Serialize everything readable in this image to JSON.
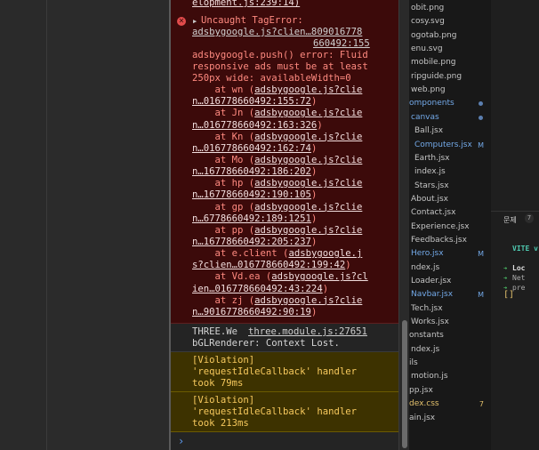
{
  "console": {
    "error": {
      "top_line": "elopment.js:239:14)",
      "title": "Uncaught TagError:",
      "title_link": "adsbygoogle.js?clien…809016778",
      "title_link2": "660492:155",
      "msg1": "adsbygoogle.push() error: Fluid",
      "msg2": "responsive ads must be at least",
      "msg3": "250px wide: availableWidth=0",
      "stack": [
        {
          "prefix": "    at wn (",
          "link": "adsbygoogle.js?clie",
          "link2": "n…016778660492:155:72",
          "suffix": ")"
        },
        {
          "prefix": "    at Jn (",
          "link": "adsbygoogle.js?clie",
          "link2": "n…016778660492:163:326",
          "suffix": ")"
        },
        {
          "prefix": "    at Kn (",
          "link": "adsbygoogle.js?clie",
          "link2": "n…016778660492:162:74",
          "suffix": ")"
        },
        {
          "prefix": "    at Mo (",
          "link": "adsbygoogle.js?clie",
          "link2": "n…16778660492:186:202",
          "suffix": ")"
        },
        {
          "prefix": "    at hp (",
          "link": "adsbygoogle.js?clie",
          "link2": "n…16778660492:190:105",
          "suffix": ")"
        },
        {
          "prefix": "    at gp (",
          "link": "adsbygoogle.js?clie",
          "link2": "n…6778660492:189:1251",
          "suffix": ")"
        },
        {
          "prefix": "    at pp (",
          "link": "adsbygoogle.js?clie",
          "link2": "n…16778660492:205:237",
          "suffix": ")"
        },
        {
          "prefix": "    at e.client (",
          "link": "adsbygoogle.j",
          "link2": "s?clien…016778660492:199:42",
          "suffix": ")"
        },
        {
          "prefix": "    at Vd.ea (",
          "link": "adsbygoogle.js?cl",
          "link2": "ien…016778660492:43:224",
          "suffix": ")"
        },
        {
          "prefix": "    at zj (",
          "link": "adsbygoogle.js?clie",
          "link2": "n…9016778660492:90:19",
          "suffix": ")"
        }
      ]
    },
    "info": {
      "text1": "THREE.We",
      "link": "three.module.js:27651",
      "text2": "bGLRenderer: Context Lost."
    },
    "warn1": [
      "[Violation]",
      "'requestIdleCallback' handler",
      "took 79ms"
    ],
    "warn2": [
      "[Violation]",
      "'requestIdleCallback' handler",
      "took 213ms"
    ],
    "prompt": "›"
  },
  "explorer": {
    "items": [
      {
        "name": "obit.png",
        "x": 2,
        "color": "",
        "badge": ""
      },
      {
        "name": "cosy.svg",
        "x": 2,
        "color": "",
        "badge": ""
      },
      {
        "name": "ogotab.png",
        "x": 2,
        "color": "",
        "badge": ""
      },
      {
        "name": "enu.svg",
        "x": 2,
        "color": "",
        "badge": ""
      },
      {
        "name": "mobile.png",
        "x": 2,
        "color": "",
        "badge": ""
      },
      {
        "name": "ripguide.png",
        "x": 2,
        "color": "",
        "badge": ""
      },
      {
        "name": "web.png",
        "x": 2,
        "color": "",
        "badge": ""
      },
      {
        "name": "omponents",
        "x": 0,
        "color": "blue",
        "badge": "dot"
      },
      {
        "name": "canvas",
        "x": 2,
        "color": "blue",
        "badge": "dot"
      },
      {
        "name": "Ball.jsx",
        "x": 6,
        "color": "",
        "badge": ""
      },
      {
        "name": "Computers.jsx",
        "x": 6,
        "color": "blue",
        "badge": "M"
      },
      {
        "name": "Earth.jsx",
        "x": 6,
        "color": "",
        "badge": ""
      },
      {
        "name": "index.js",
        "x": 6,
        "color": "",
        "badge": ""
      },
      {
        "name": "Stars.jsx",
        "x": 6,
        "color": "",
        "badge": ""
      },
      {
        "name": "About.jsx",
        "x": 2,
        "color": "",
        "badge": ""
      },
      {
        "name": "Contact.jsx",
        "x": 2,
        "color": "",
        "badge": ""
      },
      {
        "name": "Experience.jsx",
        "x": 2,
        "color": "",
        "badge": ""
      },
      {
        "name": "Feedbacks.jsx",
        "x": 2,
        "color": "",
        "badge": ""
      },
      {
        "name": "Hero.jsx",
        "x": 2,
        "color": "blue",
        "badge": "M"
      },
      {
        "name": "ndex.js",
        "x": 2,
        "color": "",
        "badge": ""
      },
      {
        "name": "Loader.jsx",
        "x": 2,
        "color": "",
        "badge": ""
      },
      {
        "name": "Navbar.jsx",
        "x": 2,
        "color": "blue",
        "badge": "M"
      },
      {
        "name": "Tech.jsx",
        "x": 2,
        "color": "",
        "badge": ""
      },
      {
        "name": "Works.jsx",
        "x": 2,
        "color": "",
        "badge": ""
      },
      {
        "name": "onstants",
        "x": 0,
        "color": "",
        "badge": ""
      },
      {
        "name": "ndex.js",
        "x": 2,
        "color": "",
        "badge": ""
      },
      {
        "name": "ils",
        "x": 0,
        "color": "",
        "badge": ""
      },
      {
        "name": "motion.js",
        "x": 2,
        "color": "",
        "badge": ""
      },
      {
        "name": "pp.jsx",
        "x": 0,
        "color": "",
        "badge": ""
      },
      {
        "name": "dex.css",
        "x": 0,
        "color": "yellow",
        "badge": "7"
      },
      {
        "name": "ain.jsx",
        "x": 0,
        "color": "",
        "badge": ""
      }
    ]
  },
  "terminal": {
    "tab_label": "문제",
    "tab_count": "7",
    "vite": "VITE v",
    "lines": [
      "Loc",
      "Net",
      "pre"
    ],
    "cursor": "[]"
  }
}
